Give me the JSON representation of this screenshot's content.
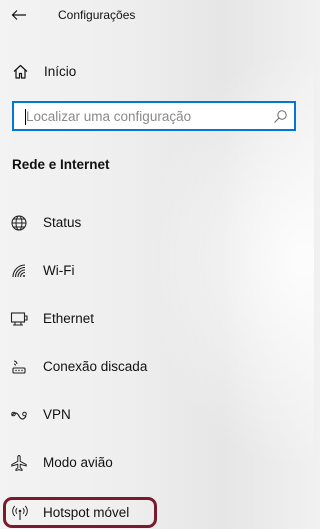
{
  "window": {
    "title": "Configurações"
  },
  "home": {
    "label": "Início"
  },
  "search": {
    "placeholder": "Localizar uma configuração"
  },
  "section": {
    "title": "Rede e Internet"
  },
  "nav": {
    "items": [
      {
        "label": "Status",
        "icon": "globe-icon"
      },
      {
        "label": "Wi-Fi",
        "icon": "wifi-icon"
      },
      {
        "label": "Ethernet",
        "icon": "ethernet-icon"
      },
      {
        "label": "Conexão discada",
        "icon": "dialup-icon"
      },
      {
        "label": "VPN",
        "icon": "vpn-icon"
      },
      {
        "label": "Modo avião",
        "icon": "airplane-icon"
      },
      {
        "label": "Hotspot móvel",
        "icon": "hotspot-icon"
      }
    ],
    "selected": "Hotspot móvel"
  },
  "colors": {
    "accent": "#0078d7",
    "selection_outline": "#7a1a2e"
  }
}
